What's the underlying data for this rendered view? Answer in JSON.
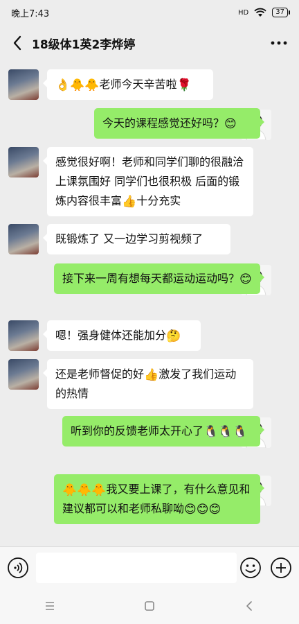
{
  "status_bar": {
    "time": "晚上7:43",
    "signal": "HD",
    "battery": "37"
  },
  "header": {
    "title": "18级体1英2李烨婷"
  },
  "messages": [
    {
      "side": "in",
      "text": "老师今天辛苦啦",
      "emoji_before": [
        "👌",
        "🐥",
        "🐥"
      ],
      "emoji_after": [
        "🌹"
      ]
    },
    {
      "side": "out",
      "text": "今天的课程感觉还好吗？",
      "emoji_after": [
        "😊"
      ]
    },
    {
      "side": "in",
      "text": "感觉很好啊！老师和同学们聊的很融洽 上课氛围好 同学们也很积极 后面的锻炼内容很丰富",
      "emoji_after": [
        "👍"
      ],
      "text_after": "十分充实"
    },
    {
      "side": "in",
      "text": "既锻炼了 又一边学习剪视频了"
    },
    {
      "side": "out",
      "text": "接下来一周有想每天都运动运动吗？",
      "emoji_after": [
        "😊"
      ]
    },
    {
      "side": "in",
      "text": "嗯！强身健体还能加分",
      "emoji_after": [
        "🤔"
      ]
    },
    {
      "side": "in",
      "text": "还是老师督促的好",
      "emoji_after": [
        "👍"
      ],
      "text_after": "激发了我们运动的热情"
    },
    {
      "side": "out",
      "text": "听到你的反馈老师太开心了",
      "emoji_after": [
        "🐧",
        "🐧",
        "🐧"
      ]
    },
    {
      "side": "out",
      "text": "我又要上课了，有什么意见和建议都可以和老师私聊呦",
      "emoji_before": [
        "🐥",
        "🐥",
        "🐥"
      ],
      "emoji_after": [
        "😊",
        "😊",
        "😊"
      ]
    }
  ],
  "icons": {
    "back": "chevron-left-icon",
    "more": "more-dots-icon",
    "voice": "voice-icon",
    "emoji": "emoji-icon",
    "plus": "plus-icon"
  },
  "colors": {
    "out_bubble": "#95ec69",
    "in_bubble": "#ffffff",
    "background": "#ededed"
  }
}
